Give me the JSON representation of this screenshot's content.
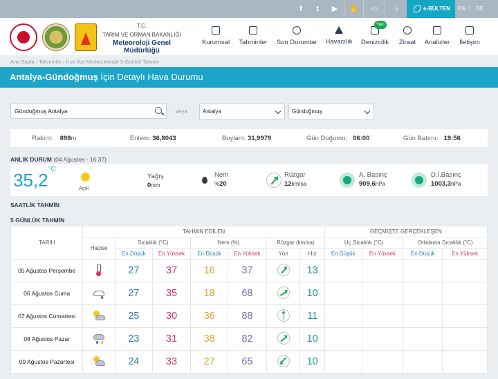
{
  "topbar": {
    "icons": [
      "facebook-icon",
      "twitter-icon",
      "youtube-icon",
      "hand-icon",
      "tv-icon",
      "microphone-icon"
    ],
    "ebulten_label": "e-BÜLTEN",
    "languages": [
      "EN",
      "DE"
    ]
  },
  "org": {
    "line1": "T.C.",
    "line2": "TARIM VE ORMAN BAKANLIĞI",
    "line3": "Meteoroloji Genel Müdürlüğü"
  },
  "nav": {
    "items": [
      {
        "label": "Kurumsal",
        "icon": "book-icon"
      },
      {
        "label": "Tahminler",
        "icon": "chart-icon"
      },
      {
        "label": "Son Durumlar",
        "icon": "check-circle-icon"
      },
      {
        "label": "Havacılık",
        "icon": "airplane-icon"
      },
      {
        "label": "Denizcilik",
        "icon": "ship-icon"
      },
      {
        "label": "Ziraat",
        "icon": "leaf-icon"
      },
      {
        "label": "Analizler",
        "icon": "analysis-icon"
      },
      {
        "label": "İletişim",
        "icon": "mail-icon"
      }
    ],
    "new_badge": "Yeni"
  },
  "breadcrumb": "Ana Sayfa › Tahminler › İl ve İlçe Merkezlerinde 5 Günlük Tahmin",
  "title": {
    "place": "Antalya-Gündoğmuş",
    "suffix": "İçin Detaylı Hava Durumu"
  },
  "search": {
    "value": "Gündoğmuş Antalya",
    "or_label": "veya",
    "province_selected": "Antalya",
    "district_selected": "Gündoğmuş"
  },
  "info": {
    "rakim_label": "Rakım:",
    "rakim_value": "898",
    "rakim_unit": "m",
    "enlem_label": "Enlem:",
    "enlem_value": "36,8043",
    "boylam_label": "Boylam:",
    "boylam_value": "31,9979",
    "dogumu_label": "Gün Doğumu:",
    "dogumu_value": "06:00",
    "batimi_label": "Gün Batımı:",
    "batimi_value": "19:56"
  },
  "current": {
    "heading": "ANLIK DURUM",
    "timestamp": "(04 Ağustos - 16.37)",
    "temp": "35,2",
    "temp_unit": "°C",
    "condition": "Açık",
    "yagis_label": "Yağış",
    "yagis_value": "0",
    "yagis_unit": "mm",
    "nem_label": "Nem",
    "nem_prefix": "%",
    "nem_value": "20",
    "ruzgar_label": "Rüzgar",
    "ruzgar_value": "12",
    "ruzgar_unit": "km/sa",
    "abasinc_label": "A. Basınç",
    "abasinc_value": "909,6",
    "abasinc_unit": "hPa",
    "dbasinc_label": "D.İ.Basınç",
    "dbasinc_value": "1003,3",
    "dbasinc_unit": "hPa"
  },
  "saatlik_heading": "SAATLİK TAHMİN",
  "gunluk_heading": "5 GÜNLÜK TAHMİN",
  "table": {
    "tarih": "TARİH",
    "tahmin_edilen": "TAHMİN EDİLEN",
    "gecmiste": "GEÇMİŞTE GERÇEKLEŞEN",
    "hadise": "Hadise",
    "sicaklik": "Sıcaklık (°C)",
    "nem": "Nem (%)",
    "ruzgar": "Rüzgar (km/sa)",
    "uc_sicaklik": "Uç Sıcaklık (°C)",
    "ort_sicaklik": "Ortalama Sıcaklık (°C)",
    "en_dusuk": "En Düşük",
    "en_yuksek": "En Yüksek",
    "yon": "Yön",
    "hiz": "Hız",
    "rows": [
      {
        "date": "05 Ağustos Perşembe",
        "icon": "thermometer-icon",
        "tmin": "27",
        "tmax": "37",
        "hmin": "16",
        "hmax": "37",
        "dir": "northeast",
        "speed": "13"
      },
      {
        "date": "06 Ağustos Cuma",
        "icon": "cloud-rain-icon",
        "tmin": "27",
        "tmax": "35",
        "hmin": "18",
        "hmax": "68",
        "dir": "northeast",
        "speed": "10"
      },
      {
        "date": "07 Ağustos Cumartesi",
        "icon": "partly-cloudy-icon",
        "tmin": "25",
        "tmax": "30",
        "hmin": "36",
        "hmax": "88",
        "dir": "north",
        "speed": "11"
      },
      {
        "date": "08 Ağustos Pazar",
        "icon": "thunder-rain-icon",
        "tmin": "23",
        "tmax": "31",
        "hmin": "38",
        "hmax": "82",
        "dir": "northeast",
        "speed": "10"
      },
      {
        "date": "09 Ağustos Pazartesi",
        "icon": "partly-cloudy-icon",
        "tmin": "24",
        "tmax": "33",
        "hmin": "27",
        "hmax": "65",
        "dir": "southwest",
        "speed": "10"
      }
    ]
  }
}
